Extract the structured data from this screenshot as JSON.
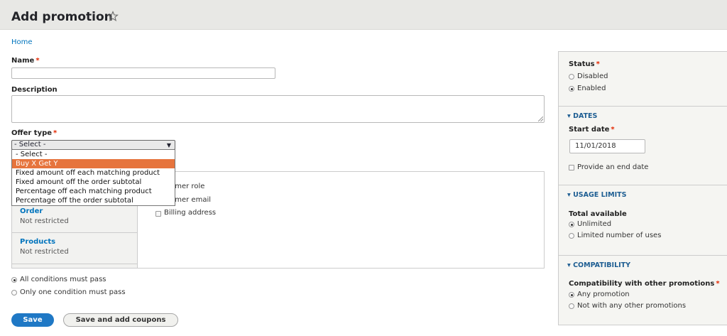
{
  "page": {
    "title": "Add promotion"
  },
  "breadcrumb": {
    "home": "Home"
  },
  "fields": {
    "name": {
      "label": "Name",
      "value": "",
      "required_mark": "*"
    },
    "description": {
      "label": "Description",
      "value": ""
    },
    "offer_type": {
      "label": "Offer type",
      "required_mark": "*",
      "selected": "- Select -",
      "options": [
        "- Select -",
        "Buy X Get Y",
        "Fixed amount off each matching product",
        "Fixed amount off the order subtotal",
        "Percentage off each matching product",
        "Percentage off the order subtotal"
      ],
      "highlighted_index": 1
    }
  },
  "conditions": {
    "tabs": [
      {
        "title": "Order",
        "status": "Not restricted"
      },
      {
        "title": "Products",
        "status": "Not restricted"
      }
    ],
    "options": [
      "stomer role",
      "stomer email",
      "Billing address"
    ],
    "operator": [
      {
        "label": "All conditions must pass",
        "checked": true
      },
      {
        "label": "Only one condition must pass",
        "checked": false
      }
    ]
  },
  "actions": {
    "save": "Save",
    "save_coupons": "Save and add coupons"
  },
  "sidebar": {
    "status": {
      "label": "Status",
      "options": [
        {
          "label": "Disabled",
          "checked": false
        },
        {
          "label": "Enabled",
          "checked": true
        }
      ]
    },
    "dates": {
      "heading": "DATES",
      "start_label": "Start date",
      "start_value": "11/01/2018",
      "end_checkbox": "Provide an end date"
    },
    "usage": {
      "heading": "USAGE LIMITS",
      "total_label": "Total available",
      "options": [
        {
          "label": "Unlimited",
          "checked": true
        },
        {
          "label": "Limited number of uses",
          "checked": false
        }
      ]
    },
    "compatibility": {
      "heading": "COMPATIBILITY",
      "label": "Compatibility with other promotions",
      "options": [
        {
          "label": "Any promotion",
          "checked": true
        },
        {
          "label": "Not with any other promotions",
          "checked": false
        }
      ]
    }
  },
  "colors": {
    "link": "#0074bd",
    "primary_button": "#1f78c5",
    "highlight": "#e6743d",
    "required": "#e32700"
  },
  "icons": {
    "star": "star-outline-icon",
    "disclosure": "triangle-down-icon"
  }
}
